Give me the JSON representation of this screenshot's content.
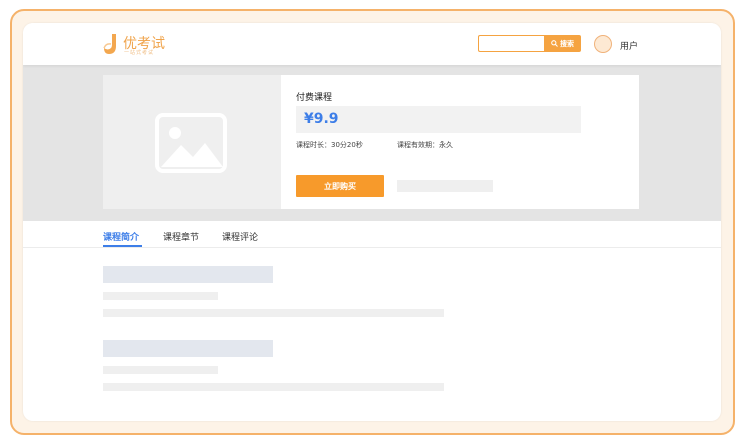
{
  "brand": {
    "name": "优考试",
    "tagline": "一站式考试"
  },
  "header": {
    "search_label": "搜索",
    "search_placeholder": "",
    "user_label": "用户"
  },
  "course": {
    "type_label": "付费课程",
    "price": "¥9.9",
    "duration": "课程时长：30分20秒",
    "validity": "课程有效期：永久",
    "buy_label": "立即购买"
  },
  "tabs": [
    {
      "label": "课程简介",
      "active": true
    },
    {
      "label": "课程章节",
      "active": false
    },
    {
      "label": "课程评论",
      "active": false
    }
  ],
  "colors": {
    "accent": "#f79a2b",
    "link": "#3d7ee8",
    "frame": "#f5b26a"
  }
}
